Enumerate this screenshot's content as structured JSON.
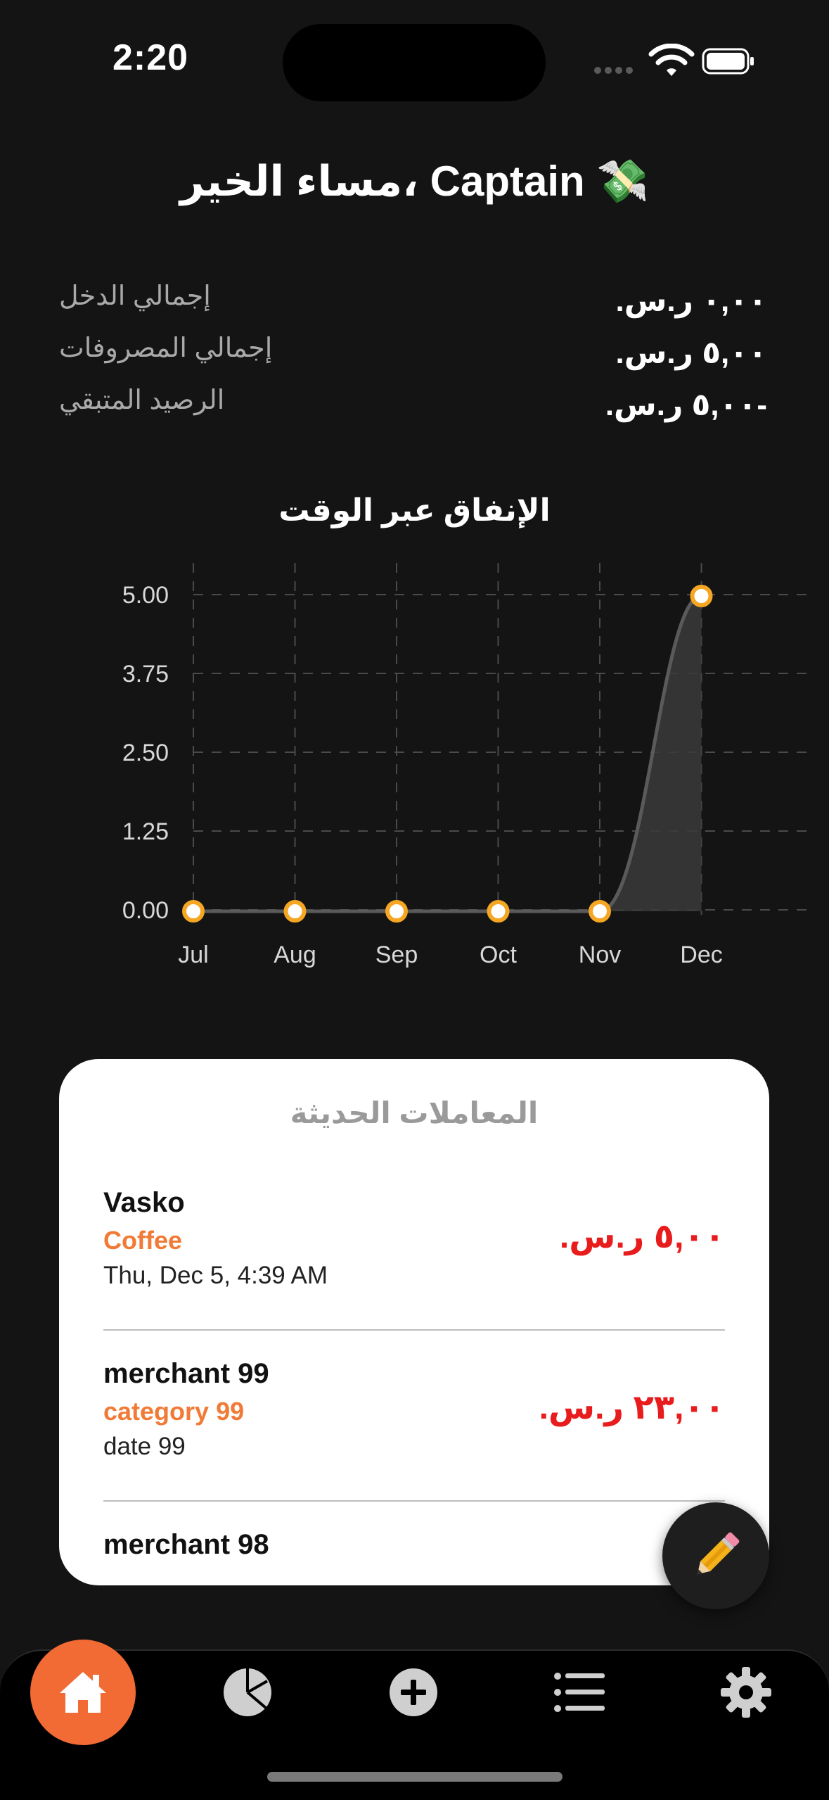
{
  "status_bar": {
    "time": "2:20"
  },
  "greeting": "مساء الخير، Captain 💸",
  "summary": [
    {
      "label": "إجمالي الدخل",
      "value": "٠,٠٠ ر.س."
    },
    {
      "label": "إجمالي المصروفات",
      "value": "٥,٠٠ ر.س."
    },
    {
      "label": "الرصيد المتبقي",
      "value": "-٥,٠٠ ر.س."
    }
  ],
  "chart_data": {
    "type": "area",
    "title": "الإنفاق عبر الوقت",
    "categories": [
      "Jul",
      "Aug",
      "Sep",
      "Oct",
      "Nov",
      "Dec"
    ],
    "values": [
      0,
      0,
      0,
      0,
      0,
      5
    ],
    "y_ticks": [
      "5.00",
      "3.75",
      "2.50",
      "1.25",
      "0.00"
    ],
    "ylim": [
      0,
      5
    ],
    "grid": true,
    "colors": {
      "line": "#5a5a5a",
      "fill": "#3a3a3a",
      "marker": "#f5a623"
    }
  },
  "transactions_card": {
    "title": "المعاملات الحديثة",
    "items": [
      {
        "merchant": "Vasko",
        "category": "Coffee",
        "date": "Thu, Dec 5, 4:39 AM",
        "amount": "٥,٠٠ ر.س."
      },
      {
        "merchant": "merchant 99",
        "category": "category 99",
        "date": "date 99",
        "amount": "٢٣,٠٠ ر.س."
      },
      {
        "merchant": "merchant 98",
        "category": "",
        "date": "",
        "amount": ""
      }
    ]
  },
  "fab_icon": "pencil-icon",
  "tabbar": {
    "active": "home",
    "tabs": [
      "home-icon",
      "pie-chart-icon",
      "add-icon",
      "list-icon",
      "settings-icon"
    ]
  },
  "colors": {
    "accent": "#f26a34",
    "expense": "#e81c1c",
    "category": "#f07a36",
    "background": "#141414"
  }
}
